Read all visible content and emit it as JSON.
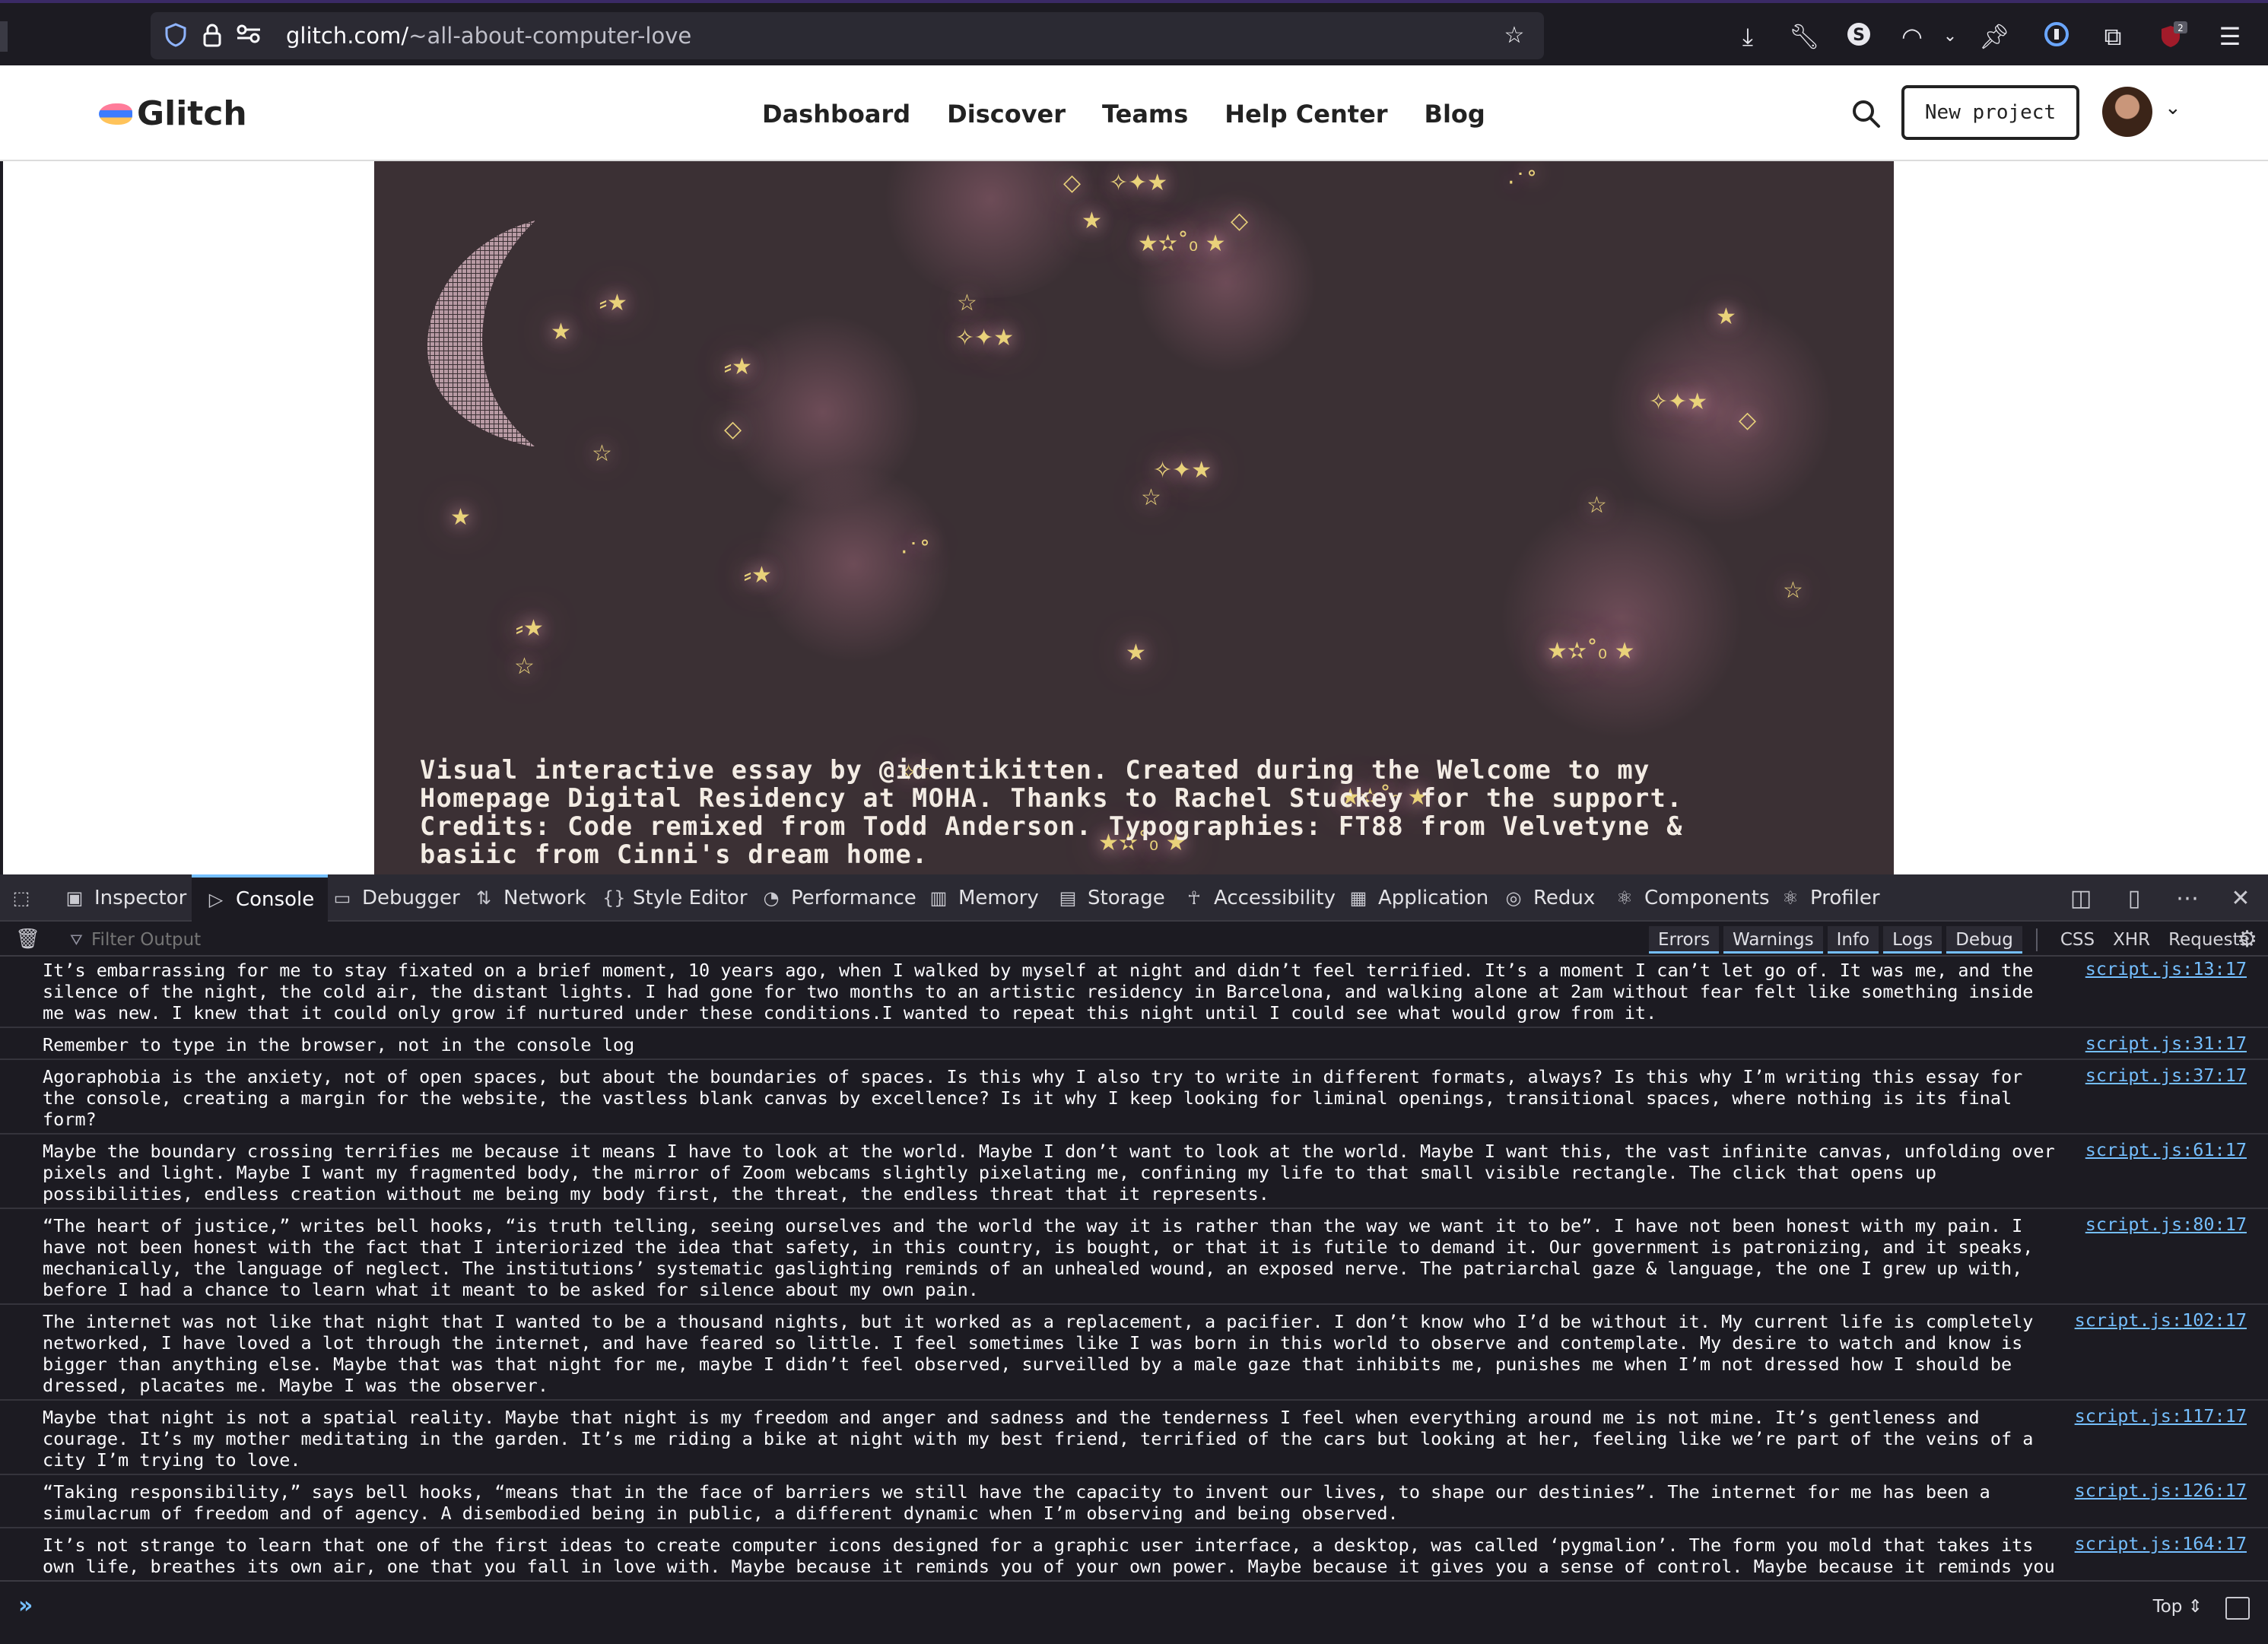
{
  "browser": {
    "url_domain": "glitch.com/",
    "url_path": "~all-about-computer-love",
    "extension_badge": "2"
  },
  "glitch_header": {
    "logo_text": "Glitch",
    "nav": [
      "Dashboard",
      "Discover",
      "Teams",
      "Help Center",
      "Blog"
    ],
    "new_project_label": "New project"
  },
  "canvas": {
    "essay_line1": "Visual interactive essay by @identikitten. Created during the Welcome to my",
    "essay_line2": "Homepage Digital Residency at MOHA. Thanks to Rachel Stuckey for the support.",
    "essay_line3": "Credits: Code remixed from Todd Anderson. Typographies: FT88 from Velvetyne &",
    "essay_line4": "basiic from Cinni's dream home.",
    "star_color": "#e9d27a",
    "bg_color": "#3b3034"
  },
  "devtools": {
    "tabs": [
      "Inspector",
      "Console",
      "Debugger",
      "Network",
      "Style Editor",
      "Performance",
      "Memory",
      "Storage",
      "Accessibility",
      "Application",
      "Redux",
      "Components",
      "Profiler"
    ],
    "selected_tab": "Console",
    "filter_placeholder": "Filter Output",
    "levels": [
      "Errors",
      "Warnings",
      "Info",
      "Logs",
      "Debug"
    ],
    "categories": [
      "CSS",
      "XHR",
      "Requests"
    ],
    "context_selector": "Top",
    "accent": "#75bfff",
    "messages": [
      {
        "text": "It’s embarrassing for me to stay fixated on a brief moment, 10 years ago, when I walked by myself at night and didn’t feel terrified. It’s a moment I can’t let go of. It was me, and the silence of the night, the cold air, the distant lights. I had gone for two months to an artistic residency in Barcelona, and walking alone at 2am without fear felt like something inside me was new. I knew that it could only grow if nurtured under these conditions.I wanted to repeat this night until I could see what would grow from it.",
        "source": "script.js:13:17"
      },
      {
        "text": "Remember to type in the browser, not in the console log",
        "source": "script.js:31:17"
      },
      {
        "text": "Agoraphobia is the anxiety, not of open spaces, but about the boundaries of spaces. Is this why I also try to write in different formats, always? Is this why I’m writing this essay for the console, creating a margin for the website, the vastless blank canvas by excellence? Is it why I keep looking for liminal openings, transitional spaces, where nothing is its final form?",
        "source": "script.js:37:17"
      },
      {
        "text": "Maybe the boundary crossing terrifies me because it means I have to look at the world. Maybe I don’t want to look at the world. Maybe I want this, the vast infinite canvas, unfolding over pixels and light. Maybe I want my fragmented body, the mirror of Zoom webcams slightly pixelating me, confining my life to that small visible rectangle. The click that opens up possibilities, endless creation without me being my body first, the threat, the endless threat that it represents.",
        "source": "script.js:61:17"
      },
      {
        "text": "“The heart of justice,” writes bell hooks, “is truth telling, seeing ourselves and the world the way it is rather than the way we want it to be”. I have not been honest with my pain. I have not been honest with the fact that I interiorized the idea that safety, in this country, is bought, or that it is futile to demand it. Our government is patronizing, and it speaks, mechanically, the language of neglect. The institutions’ systematic gaslighting reminds of an unhealed wound, an exposed nerve. The patriarchal gaze & language, the one I grew up with, before I had a chance to learn what it meant to be asked for silence about my own pain.",
        "source": "script.js:80:17"
      },
      {
        "text": "The internet was not like that night that I wanted to be a thousand nights, but it worked as a replacement, a pacifier. I don’t know who I’d be without it. My current life is completely networked, I have loved a lot through the internet, and have feared so little. I feel sometimes like I was born in this world to observe and contemplate. My desire to watch and know is bigger than anything else. Maybe that was that night for me, maybe I didn’t feel observed, surveilled by a male gaze that inhibits me, punishes me when I’m not dressed how I should be dressed, placates me. Maybe I was the observer.",
        "source": "script.js:102:17"
      },
      {
        "text": "Maybe that night is not a spatial reality. Maybe that night is my freedom and anger and sadness and the tenderness I feel when everything around me is not mine. It’s gentleness and courage. It’s my mother meditating in the garden. It’s me riding a bike at night with my best friend, terrified of the cars but looking at her, feeling like we’re part of the veins of a city I’m trying to love.",
        "source": "script.js:117:17"
      },
      {
        "text": "“Taking responsibility,” says bell hooks, “means that in the face of barriers we still have the capacity to invent our lives, to shape our destinies”. The internet for me has been a simulacrum of freedom and of agency. A disembodied being in public, a different dynamic when I’m observing and being observed.",
        "source": "script.js:126:17"
      },
      {
        "text": "It’s not strange to learn that one of the first ideas to create computer icons designed for a graphic user interface, a desktop, was called ‘pygmalion’. The form you mold that takes its own life, breathes its own air, one that you fall in love with. Maybe because it reminds you of your own power. Maybe because it gives you a sense of control. Maybe because it reminds you that outside of your own desires of what the world should be, there’s one that already exists, with rules set in motion, with a kind of vitality that will breathe inside anything you create. Maybe I build a home from that night feeling. Maybe that's from where I'll look back at the world.",
        "source": "script.js:164:17"
      }
    ]
  }
}
